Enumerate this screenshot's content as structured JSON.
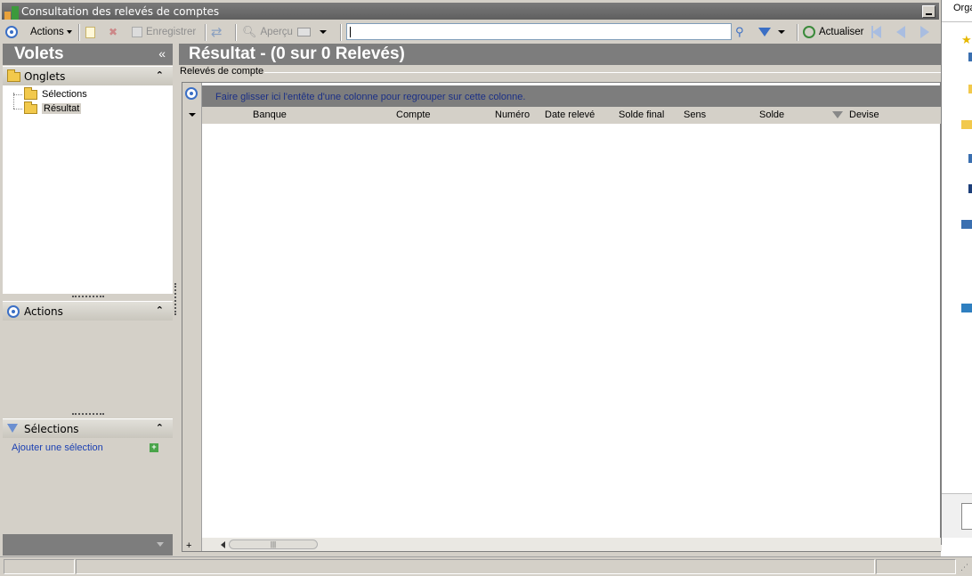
{
  "window": {
    "title": "Consultation des relevés de comptes"
  },
  "toolbar": {
    "actions_label": "Actions",
    "save_label": "Enregistrer",
    "preview_label": "Aperçu",
    "search_value": "",
    "refresh_label": "Actualiser"
  },
  "left": {
    "title": "Volets",
    "collapse_glyph": "«",
    "onglets": {
      "title": "Onglets",
      "items": [
        {
          "label": "Sélections"
        },
        {
          "label": "Résultat"
        }
      ]
    },
    "actions": {
      "title": "Actions"
    },
    "selections": {
      "title": "Sélections",
      "add_link": "Ajouter une sélection"
    }
  },
  "result": {
    "title": "Résultat - (0 sur 0 Relevés)",
    "group_label": "Relevés de compte",
    "group_hint": "Faire glisser ici l'entête d'une colonne pour regrouper sur cette colonne.",
    "columns": [
      "Banque",
      "Compte",
      "Numéro",
      "Date relevé",
      "Solde final",
      "Sens",
      "Solde",
      "Devise"
    ]
  },
  "background_window": {
    "title_fragment": "Orga"
  },
  "colors": {
    "header_gray": "#7d7d7d",
    "face": "#d4d0c8",
    "link_blue": "#1a3fb2",
    "accent_blue": "#3b6fc5"
  }
}
